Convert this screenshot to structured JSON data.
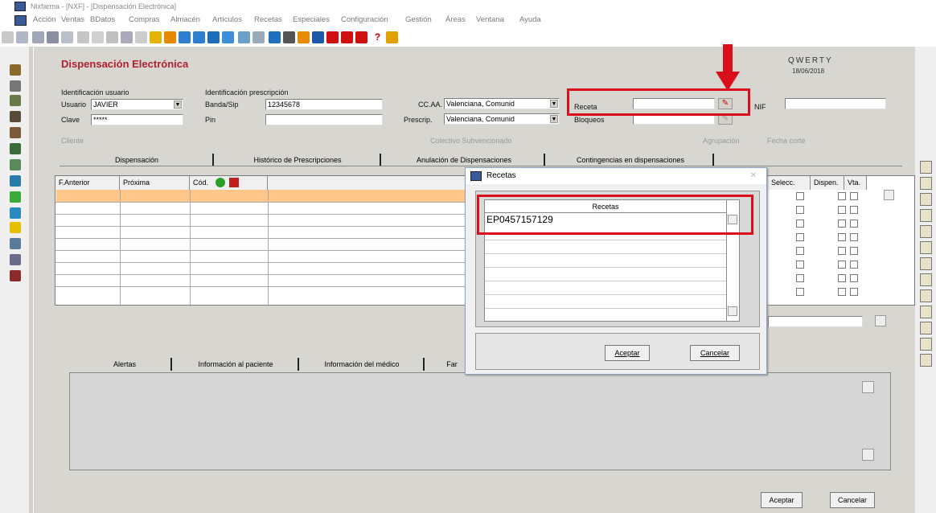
{
  "window": {
    "title": "Nixfarma - [NXF] - [Dispensación Electrónica]"
  },
  "menu": [
    "Acción",
    "Ventas",
    "BDatos",
    "Compras",
    "Almacén",
    "Artículos",
    "Recetas",
    "Especiales",
    "Configuración",
    "Gestión",
    "Áreas",
    "Ventana",
    "Ayuda"
  ],
  "header": {
    "title": "Dispensación Electrónica",
    "brand": "QWERTY",
    "date": "18/06/2018"
  },
  "form": {
    "user_section_label": "Identificación usuario",
    "usuario_label": "Usuario",
    "usuario_value": "JAVIER",
    "clave_label": "Clave",
    "clave_value": "*****",
    "presc_section_label": "Identificación prescripción",
    "banda_label": "Banda/Sip",
    "banda_value": "12345678",
    "pin_label": "Pin",
    "ccaa_label": "CC.AA.",
    "ccaa_value": "Valenciana, Comunid",
    "prescrip_label": "Prescrip.",
    "prescrip_value": "Valenciana, Comunid",
    "receta_label": "Receta",
    "bloqueos_label": "Bloqueos",
    "nif_label": "NIF",
    "cliente_label": "Cliente",
    "colectivo_label": "Colectivo Subvencionado",
    "agrupacion_label": "Agrupación",
    "fecha_label": "Fecha corte"
  },
  "tabs": [
    "Dispensación",
    "Histórico de Prescripciones",
    "Anulación de Dispensaciones",
    "Contingencias en dispensaciones"
  ],
  "grid": {
    "columns": [
      "F.Anterior",
      "Próxima",
      "Cód."
    ],
    "right_columns": [
      "Selecc.",
      "Dispen.",
      "Vta."
    ]
  },
  "bottom_tabs": [
    "Alertas",
    "Información al paciente",
    "Información del médico",
    "Far"
  ],
  "buttons": {
    "accept": "Aceptar",
    "cancel": "Cancelar"
  },
  "modal": {
    "title": "Recetas",
    "column_header": "Recetas",
    "first_value": "EP0457157129",
    "accept": "Aceptar",
    "cancel": "Cancelar"
  },
  "colors": {
    "title_red": "#b2202e",
    "highlight_row": "#ffc68a",
    "annotation_red": "#d90f1c"
  }
}
